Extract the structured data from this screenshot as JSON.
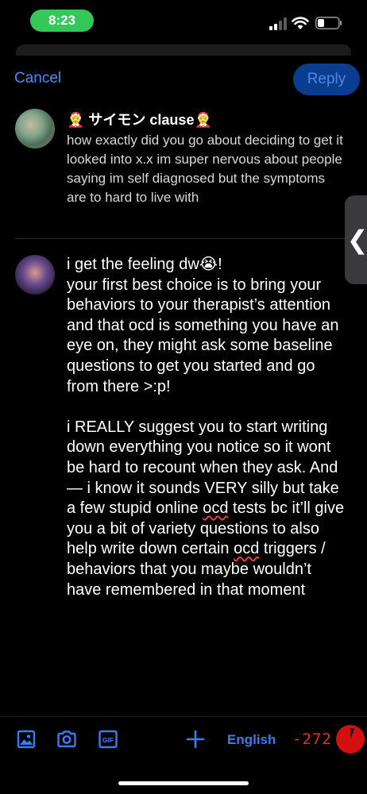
{
  "status_bar": {
    "time": "8:23",
    "colors": {
      "time_pill": "#34c759"
    }
  },
  "header": {
    "cancel_label": "Cancel",
    "reply_label": "Reply"
  },
  "original_post": {
    "author": "🤶 サイモン clause🤶",
    "text": "how exactly did you go about deciding to get it looked into x.x im super nervous about people saying im self diagnosed but the symptoms are to hard to live with"
  },
  "reply_draft": {
    "line_1": "i get the feeling dw😭!",
    "paragraph_1": "your first best choice is to bring your behaviors to your therapist’s attention and that ocd is something you have an eye on, they might ask some baseline questions to get you started and go from there >:p!",
    "paragraph_2_part_1": "i REALLY suggest you to start writing down everything you notice so it wont be hard to recount when they ask. And — i know it sounds VERY silly but take a few stupid online ",
    "paragraph_2_ocd_1": "ocd",
    "paragraph_2_part_2": " tests bc it’ll give you a bit of variety questions to also help write down certain ",
    "paragraph_2_ocd_2": "ocd",
    "paragraph_2_part_3": " triggers / behaviors that you maybe wouldn’t have remembered in that moment"
  },
  "side_tab": {
    "glyph": "❮"
  },
  "toolbar": {
    "icons": [
      "image-icon",
      "camera-icon",
      "gif-icon",
      "plus-icon"
    ],
    "gif_label": "GIF",
    "language": "English",
    "char_count": "-272",
    "colors": {
      "accent": "#3a7cf0",
      "over_limit": "#e0332e"
    }
  }
}
